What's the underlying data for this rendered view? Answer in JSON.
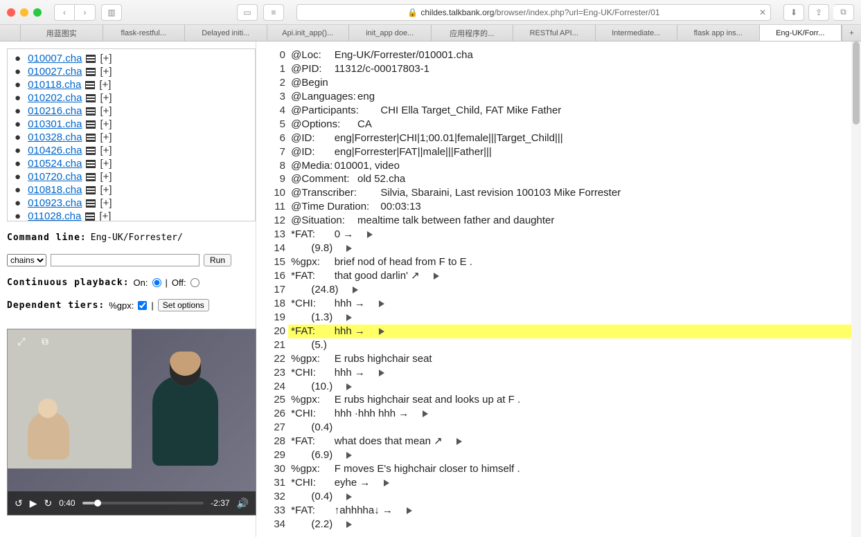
{
  "titlebar": {
    "url_host": "childes.talkbank.org",
    "url_path": "/browser/index.php?url=Eng-UK/Forrester/01"
  },
  "tabs": [
    {
      "label": ""
    },
    {
      "label": "用蓝图实"
    },
    {
      "label": "flask-restful..."
    },
    {
      "label": "Delayed initi..."
    },
    {
      "label": "Api.init_app()..."
    },
    {
      "label": "init_app doe..."
    },
    {
      "label": "应用程序的..."
    },
    {
      "label": "RESTful API..."
    },
    {
      "label": "Intermediate..."
    },
    {
      "label": "flask app ins..."
    },
    {
      "label": "Eng-UK/Forr..."
    }
  ],
  "files": [
    "010007.cha",
    "010027.cha",
    "010118.cha",
    "010202.cha",
    "010216.cha",
    "010301.cha",
    "010328.cha",
    "010426.cha",
    "010524.cha",
    "010720.cha",
    "010818.cha",
    "010923.cha",
    "011028.cha"
  ],
  "file_plus": "[+]",
  "cmd": {
    "label": "Command line:",
    "value": "Eng-UK/Forrester/",
    "select": "chains",
    "run": "Run"
  },
  "playback": {
    "label": "Continuous playback:",
    "on": "On:",
    "off": "Off:"
  },
  "tiers": {
    "label": "Dependent tiers:",
    "name": "%gpx:",
    "setopt": "Set options"
  },
  "video": {
    "elapsed": "0:40",
    "remain": "-2:37"
  },
  "lines": [
    {
      "n": 0,
      "t": "@Loc:\tEng-UK/Forrester/010001.cha"
    },
    {
      "n": 1,
      "t": "@PID:\t11312/c-00017803-1"
    },
    {
      "n": 2,
      "t": "@Begin"
    },
    {
      "n": 3,
      "t": "@Languages:\teng"
    },
    {
      "n": 4,
      "t": "@Participants:\tCHI Ella Target_Child, FAT Mike Father"
    },
    {
      "n": 5,
      "t": "@Options:\tCA"
    },
    {
      "n": 6,
      "t": "@ID:\teng|Forrester|CHI|1;00.01|female|||Target_Child|||"
    },
    {
      "n": 7,
      "t": "@ID:\teng|Forrester|FAT||male|||Father|||"
    },
    {
      "n": 8,
      "t": "@Media:\t010001, video"
    },
    {
      "n": 9,
      "t": "@Comment:\told 52.cha"
    },
    {
      "n": 10,
      "t": "@Transcriber:\tSilvia, Sbaraini, Last revision 100103 Mike Forrester"
    },
    {
      "n": 11,
      "t": "@Time Duration:\t00:03:13"
    },
    {
      "n": 12,
      "t": "@Situation:\tmealtime talk between father and daughter"
    },
    {
      "n": 13,
      "t": "*FAT:\t0 →",
      "p": true
    },
    {
      "n": 14,
      "t": "\t(9.8)",
      "p": true
    },
    {
      "n": 15,
      "t": "%gpx:\tbrief nod of head from F to E ."
    },
    {
      "n": 16,
      "t": "*FAT:\tthat good darlin' ↗",
      "p": true
    },
    {
      "n": 17,
      "t": "\t(24.8)",
      "p": true
    },
    {
      "n": 18,
      "t": "*CHI:\thhh →",
      "p": true
    },
    {
      "n": 19,
      "t": "\t(1.3)",
      "p": true
    },
    {
      "n": 20,
      "t": "*FAT:\thhh →",
      "p": true,
      "hl": true
    },
    {
      "n": 21,
      "t": "\t(5.)"
    },
    {
      "n": 22,
      "t": "%gpx:\tE rubs highchair seat"
    },
    {
      "n": 23,
      "t": "*CHI:\thhh →",
      "p": true
    },
    {
      "n": 24,
      "t": "\t(10.)",
      "p": true
    },
    {
      "n": 25,
      "t": "%gpx:\tE rubs highchair seat and looks up at F ."
    },
    {
      "n": 26,
      "t": "*CHI:\thhh ·hhh hhh →",
      "p": true
    },
    {
      "n": 27,
      "t": "\t(0.4)"
    },
    {
      "n": 28,
      "t": "*FAT:\twhat does that mean ↗",
      "p": true
    },
    {
      "n": 29,
      "t": "\t(6.9)",
      "p": true
    },
    {
      "n": 30,
      "t": "%gpx:\tF moves E's highchair closer to himself ."
    },
    {
      "n": 31,
      "t": "*CHI:\teyhe →",
      "p": true
    },
    {
      "n": 32,
      "t": "\t(0.4)",
      "p": true
    },
    {
      "n": 33,
      "t": "*FAT:\t↑ahhhha↓ →",
      "p": true
    },
    {
      "n": 34,
      "t": "\t(2.2)",
      "p": true
    }
  ]
}
